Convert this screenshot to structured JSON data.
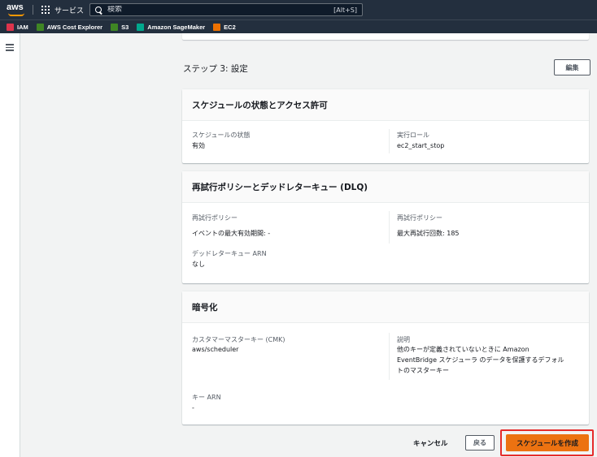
{
  "topnav": {
    "logo_text": "aws",
    "services_label": "サービス",
    "search_placeholder": "検索",
    "search_shortcut": "[Alt+S]"
  },
  "favorites": [
    {
      "label": "IAM",
      "color": "#dd344c",
      "icon": "iam-icon"
    },
    {
      "label": "AWS Cost Explorer",
      "color": "#3f8624",
      "icon": "cost-explorer-icon"
    },
    {
      "label": "S3",
      "color": "#3f8624",
      "icon": "s3-icon"
    },
    {
      "label": "Amazon SageMaker",
      "color": "#01a88d",
      "icon": "sagemaker-icon"
    },
    {
      "label": "EC2",
      "color": "#ed7100",
      "icon": "ec2-icon"
    }
  ],
  "step": {
    "title": "ステップ 3: 設定",
    "edit_label": "編集"
  },
  "schedule_card": {
    "header": "スケジュールの状態とアクセス許可",
    "state_label": "スケジュールの状態",
    "state_value": "有効",
    "role_label": "実行ロール",
    "role_value": "ec2_start_stop"
  },
  "retry_card": {
    "header": "再試行ポリシーとデッドレターキュー (DLQ)",
    "retry_label_left": "再試行ポリシー",
    "retry_value_left": "イベントの最大有効期間: -",
    "retry_label_right": "再試行ポリシー",
    "retry_value_right": "最大再試行回数: 185",
    "dlq_label": "デッドレターキュー ARN",
    "dlq_value": "なし"
  },
  "encryption_card": {
    "header": "暗号化",
    "cmk_label": "カスタマーマスターキー (CMK)",
    "cmk_value": "aws/scheduler",
    "desc_label": "説明",
    "desc_line1": "他のキーが定義されていないときに Amazon",
    "desc_line2": "EventBridge スケジューラ のデータを保護するデフォル",
    "desc_line3": "トのマスターキー",
    "key_arn_label": "キー ARN",
    "key_arn_value": "-"
  },
  "footer": {
    "cancel_label": "キャンセル",
    "back_label": "戻る",
    "create_label": "スケジュールを作成"
  }
}
